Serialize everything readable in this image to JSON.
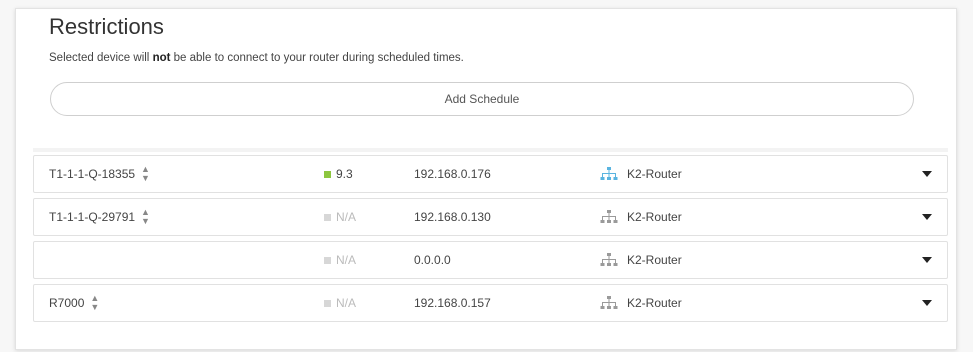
{
  "restrictions": {
    "title": "Restrictions",
    "subtitle_pre": "Selected device will ",
    "subtitle_bold": "not",
    "subtitle_post": " be able to connect to your router during scheduled times.",
    "add_button_label": "Add Schedule"
  },
  "devices": [
    {
      "name": "T1-1-1-Q-18355",
      "has_sort_icon": true,
      "signal": "9.3",
      "signal_status": "good",
      "ip": "192.168.0.176",
      "router": "K2-Router",
      "router_icon": "network-icon-active"
    },
    {
      "name": "T1-1-1-Q-29791",
      "has_sort_icon": true,
      "signal": "N/A",
      "signal_status": "none",
      "ip": "192.168.0.130",
      "router": "K2-Router",
      "router_icon": "network-icon"
    },
    {
      "name": "",
      "has_sort_icon": false,
      "signal": "N/A",
      "signal_status": "none",
      "ip": "0.0.0.0",
      "router": "K2-Router",
      "router_icon": "network-icon"
    },
    {
      "name": "R7000",
      "has_sort_icon": true,
      "signal": "N/A",
      "signal_status": "none",
      "ip": "192.168.0.157",
      "router": "K2-Router",
      "router_icon": "network-icon"
    }
  ],
  "colors": {
    "signal_good": "#8dc63f",
    "signal_none": "#d7d7d7",
    "network_icon_active": "#5ab4e0",
    "network_icon_inactive": "#9a9a9a"
  }
}
